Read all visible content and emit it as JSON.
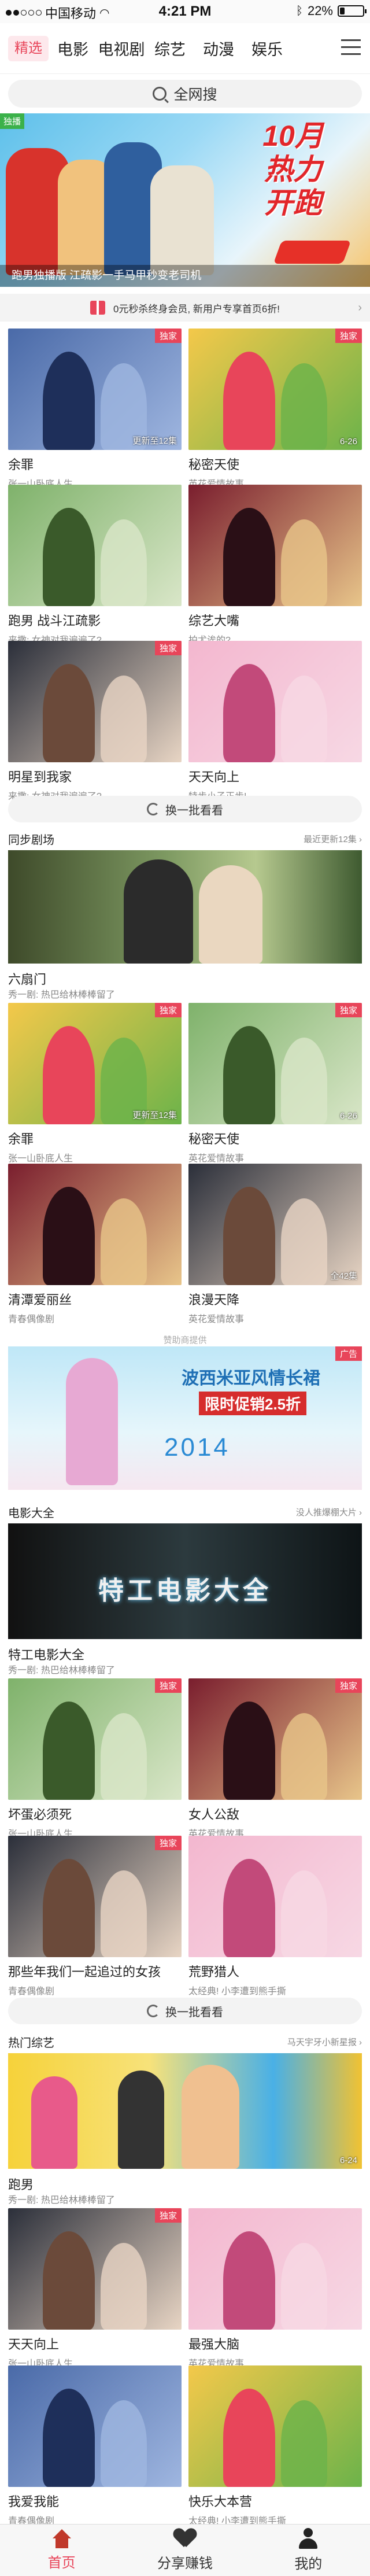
{
  "status_bar": {
    "carrier": "中国移动",
    "time": "4:21 PM",
    "battery": "22%",
    "battery_level": 0.22
  },
  "nav": {
    "tabs": [
      "精选",
      "电影",
      "电视剧",
      "综艺",
      "动漫",
      "娱乐"
    ],
    "active": 0
  },
  "search": {
    "placeholder": "全网搜"
  },
  "banner": {
    "corner": "独播",
    "headline_1": "10月",
    "headline_2": "热力",
    "headline_3": "开跑",
    "caption": "跑男独播版 江疏影一手马甲秒变老司机"
  },
  "vip_bar": {
    "text": "0元秒杀终身会员, 新用户专享首页6折!"
  },
  "featured": [
    {
      "title": "余罪",
      "sub": "张一山卧底人生",
      "tag": "独家",
      "update": "更新至12集"
    },
    {
      "title": "秘密天使",
      "sub": "英花爱情故事",
      "tag": "独家",
      "update": "6-26"
    },
    {
      "title": "跑男 战斗江疏影",
      "sub": "来撒: 女神对我遍遍了?",
      "tag": "",
      "update": ""
    },
    {
      "title": "综艺大嘴",
      "sub": "拍尤诶的?",
      "tag": "",
      "update": ""
    },
    {
      "title": "明星到我家",
      "sub": "来撒: 女神对我遍遍了?",
      "tag": "独家",
      "update": ""
    },
    {
      "title": "天天向上",
      "sub": "特步小子正步!",
      "tag": "",
      "update": ""
    }
  ],
  "swap_label": "换一批看看",
  "section_sync": {
    "title": "同步剧场",
    "more": "最近更新12集 ›"
  },
  "sync_main": {
    "title": "六扇门",
    "sub": "秀一剧: 热巴给林棒棒留了"
  },
  "sync_list": [
    {
      "title": "余罪",
      "sub": "张一山卧底人生",
      "tag": "独家",
      "update": "更新至12集"
    },
    {
      "title": "秘密天使",
      "sub": "英花爱情故事",
      "tag": "独家",
      "update": "6-26"
    },
    {
      "title": "清潭爱丽丝",
      "sub": "青春偶像剧",
      "tag": "",
      "update": ""
    },
    {
      "title": "浪漫天降",
      "sub": "英花爱情故事",
      "tag": "",
      "update": "全42集"
    }
  ],
  "ad": {
    "label": "赞助商提供",
    "tag": "广告",
    "line1": "波西米亚风情长裙",
    "line2": "限时促销2.5折",
    "year": "2014"
  },
  "section_movie": {
    "title": "电影大全",
    "more": "没人推爆棚大片 ›"
  },
  "movie_main": {
    "title": "特工电影大全",
    "sub": "秀一剧: 热巴给林棒棒留了",
    "overlay": "特工电影大全"
  },
  "movie_list": [
    {
      "title": "坏蛋必须死",
      "sub": "张一山卧底人生",
      "tag": "独家",
      "update": ""
    },
    {
      "title": "女人公敌",
      "sub": "英花爱情故事",
      "tag": "独家",
      "update": ""
    },
    {
      "title": "那些年我们一起追过的女孩",
      "sub": "青春偶像剧",
      "tag": "独家",
      "update": ""
    },
    {
      "title": "荒野猎人",
      "sub": "太经典! 小李遭到熊手撕",
      "tag": "",
      "update": ""
    }
  ],
  "section_variety": {
    "title": "热门综艺",
    "more": "马天宇牙小新星报 ›"
  },
  "variety_main": {
    "title": "跑男",
    "sub": "秀一剧: 热巴给林棒棒留了",
    "update": "6-24"
  },
  "variety_list": [
    {
      "title": "天天向上",
      "sub": "张一山卧底人生",
      "tag": "独家",
      "update": ""
    },
    {
      "title": "最强大脑",
      "sub": "英花爱情故事",
      "tag": "",
      "update": ""
    },
    {
      "title": "我爱我能",
      "sub": "青春偶像剧",
      "tag": "",
      "update": ""
    },
    {
      "title": "快乐大本营",
      "sub": "太经典! 小李遭到熊手撕",
      "tag": "",
      "update": ""
    }
  ],
  "tabbar": {
    "home": "首页",
    "share": "分享赚钱",
    "mine": "我的"
  }
}
